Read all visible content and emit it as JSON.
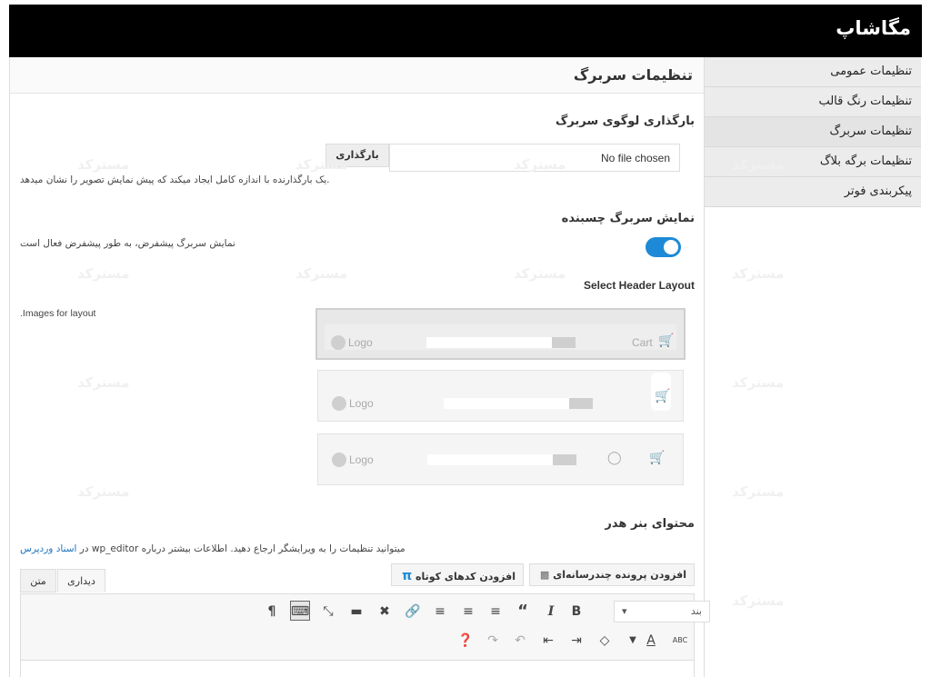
{
  "brand": "مگاشاپ",
  "sidebar": {
    "items": [
      {
        "label": "تنظیمات عمومی"
      },
      {
        "label": "تنظیمات رنگ قالب"
      },
      {
        "label": "تنظیمات سربرگ"
      },
      {
        "label": "تنظیمات برگه بلاگ"
      },
      {
        "label": "پیکربندی فوتر"
      }
    ]
  },
  "panel": {
    "title": "تنظیمات سربرگ"
  },
  "logo_upload": {
    "heading": "بارگذاری لوگوی سربرگ",
    "file_text": "No file chosen",
    "button": "بارگذاری",
    "help": "یک بارگذارنده با اندازه کامل ایجاد میکند که پیش نمایش تصویر را نشان میدهد."
  },
  "sticky": {
    "heading": "نمایش سربرگ چسبنده",
    "help": "نمایش سربرگ پیشفرض، به طور پیشفرض فعال است",
    "enabled": true
  },
  "layout": {
    "heading": "Select Header Layout",
    "help": ".Images for layout",
    "logo_text": "Logo",
    "cart_text": "Cart"
  },
  "banner": {
    "heading": "محتوای بنر هدر",
    "help": "میتوانید تنظیمات را به ویرایشگر ارجاع دهید. اطلاعات بیشتر درباره wp_editor در",
    "help_link": "اسناد وردپرس"
  },
  "editor": {
    "add_media": "افزودن پرونده چندرسانه‌ای",
    "add_shortcode": "افزودن کدهای کوتاه",
    "tab_visual": "دیداری",
    "tab_text": "متن",
    "format_select": "بند"
  },
  "watermark": "مسترکد",
  "colors": {
    "accent": "#1e8ad7",
    "topbar": "#000000"
  }
}
